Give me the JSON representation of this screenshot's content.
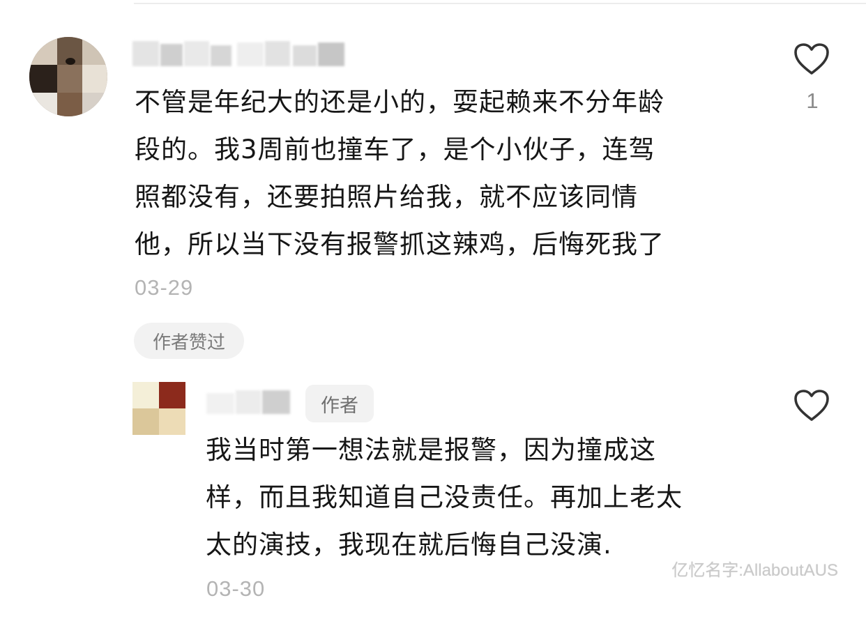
{
  "comment": {
    "text_lines": [
      "不管是年纪大的还是小的，耍起赖来不分年龄",
      "段的。我3周前也撞车了，是个小伙子，连驾",
      "照都没有，还要拍照片给我，就不应该同情",
      "他，所以当下没有报警抓这辣鸡，后悔死我了"
    ],
    "date": "03-29",
    "author_liked_label": "作者赞过",
    "like_count": "1",
    "like_icon": "heart-outline-icon"
  },
  "reply": {
    "author_badge": "作者",
    "text_lines": [
      "我当时第一想法就是报警，因为撞成这",
      "样，而且我知道自己没责任。再加上老太",
      "太的演技，我现在就后悔自己没演."
    ],
    "date": "03-30",
    "like_icon": "heart-outline-icon"
  },
  "watermark": "亿忆名字:AllaboutAUS",
  "colors": {
    "text": "#161616",
    "muted": "#b4b4b4",
    "pill_bg": "#f2f2f2",
    "icon": "#333333"
  }
}
